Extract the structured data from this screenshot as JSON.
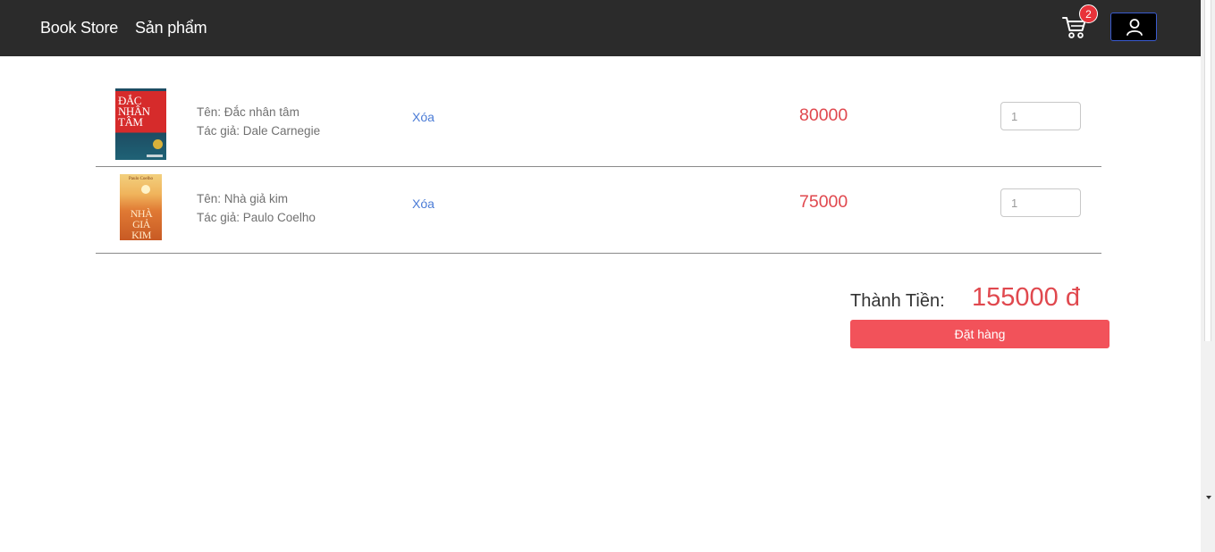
{
  "navbar": {
    "brand": "Book Store",
    "products_link": "Sản phẩm",
    "cart_count": "2",
    "cart_icon": "shopping-cart-icon",
    "user_icon": "user-icon"
  },
  "cart": {
    "items": [
      {
        "cover_title": "ĐẮC NHÂN TÂM",
        "name_line": "Tên: Đắc nhân tâm",
        "author_line": "Tác giả: Dale Carnegie",
        "delete_label": "Xóa",
        "price": "80000",
        "quantity": "1"
      },
      {
        "cover_author": "Paulo Coelho",
        "cover_title": "NHÀ GIẢ KIM",
        "name_line": "Tên: Nhà giả kim",
        "author_line": "Tác giả: Paulo Coelho",
        "delete_label": "Xóa",
        "price": "75000",
        "quantity": "1"
      }
    ],
    "total_label": "Thành Tiền:",
    "total_value": "155000 đ",
    "order_button": "Đặt hàng"
  },
  "colors": {
    "navbar_bg": "#2b2b2b",
    "price_red": "#e0484e",
    "order_button_bg": "#f2525a",
    "link_blue": "#4a7bd6",
    "badge_red": "#e8323a"
  }
}
